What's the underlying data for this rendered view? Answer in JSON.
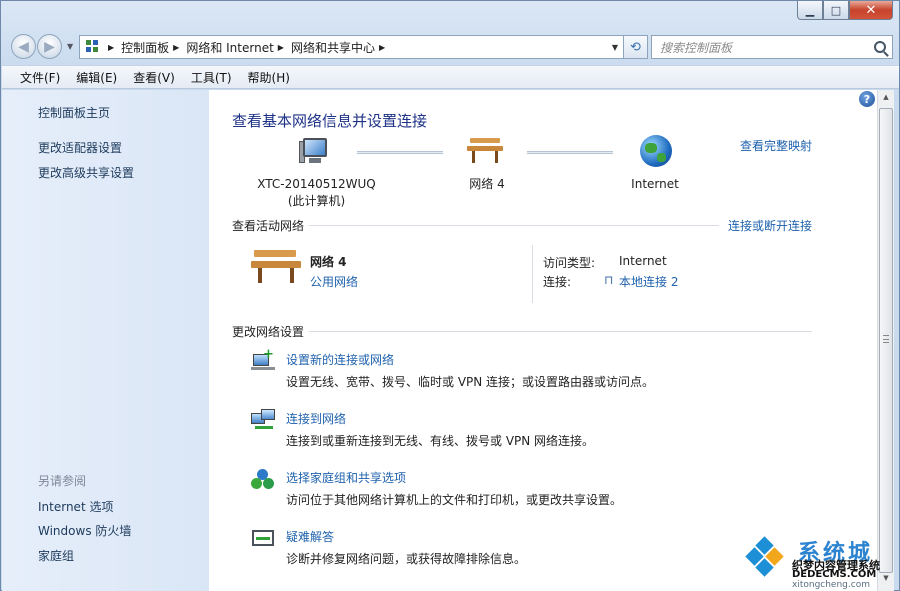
{
  "window": {
    "caption": {
      "minimize": "▁",
      "maximize": "□",
      "close": "✕"
    }
  },
  "navbar": {
    "breadcrumbs": [
      "控制面板",
      "网络和 Internet",
      "网络和共享中心"
    ],
    "search_placeholder": "搜索控制面板"
  },
  "menubar": [
    "文件(F)",
    "编辑(E)",
    "查看(V)",
    "工具(T)",
    "帮助(H)"
  ],
  "sidebar": {
    "home": "控制面板主页",
    "tasks": [
      "更改适配器设置",
      "更改高级共享设置"
    ],
    "see_also_label": "另请参阅",
    "see_also": [
      "Internet 选项",
      "Windows 防火墙",
      "家庭组"
    ]
  },
  "main": {
    "title": "查看基本网络信息并设置连接",
    "full_map_link": "查看完整映射",
    "map": {
      "computer_name": "XTC-20140512WUQ",
      "computer_sub": "(此计算机)",
      "network": "网络  4",
      "internet": "Internet"
    },
    "active": {
      "heading": "查看活动网络",
      "connect_link": "连接或断开连接",
      "network_name": "网络  4",
      "network_type": "公用网络",
      "access_type_label": "访问类型:",
      "access_type_value": "Internet",
      "connection_label": "连接:",
      "connection_value": "本地连接 2"
    },
    "change": {
      "heading": "更改网络设置",
      "tasks": [
        {
          "title": "设置新的连接或网络",
          "desc": "设置无线、宽带、拨号、临时或 VPN 连接；或设置路由器或访问点。",
          "icon": "new-connection-icon"
        },
        {
          "title": "连接到网络",
          "desc": "连接到或重新连接到无线、有线、拨号或 VPN 网络连接。",
          "icon": "connect-network-icon"
        },
        {
          "title": "选择家庭组和共享选项",
          "desc": "访问位于其他网络计算机上的文件和打印机，或更改共享设置。",
          "icon": "homegroup-icon"
        },
        {
          "title": "疑难解答",
          "desc": "诊断并修复网络问题，或获得故障排除信息。",
          "icon": "troubleshoot-icon"
        }
      ]
    }
  },
  "watermark": {
    "brand": "系统城",
    "line1": "织梦内容管理系统",
    "line2": "DEDECMS.COM",
    "url": "xitongcheng.com"
  },
  "colors": {
    "link": "#1f62ad",
    "title": "#1e3287",
    "sidebar_link": "#1d3b5c"
  }
}
